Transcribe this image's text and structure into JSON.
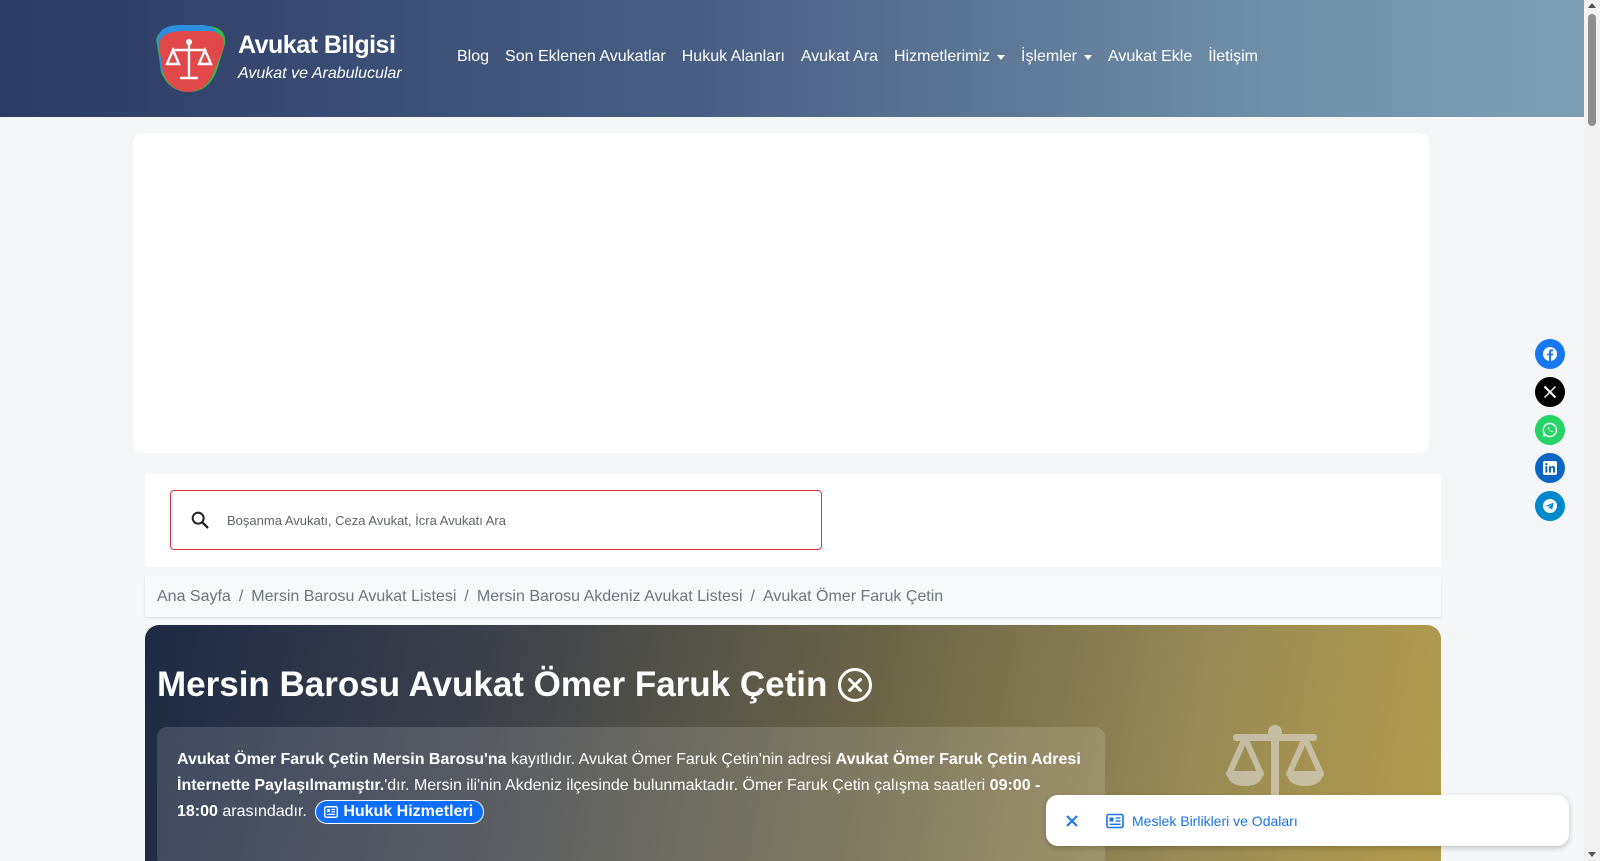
{
  "brand": {
    "title": "Avukat Bilgisi",
    "subtitle": "Avukat ve Arabulucular"
  },
  "nav": {
    "items": [
      {
        "label": "Blog",
        "dropdown": false
      },
      {
        "label": "Son Eklenen Avukatlar",
        "dropdown": false
      },
      {
        "label": "Hukuk Alanları",
        "dropdown": false
      },
      {
        "label": "Avukat Ara",
        "dropdown": false
      },
      {
        "label": "Hizmetlerimiz",
        "dropdown": true
      },
      {
        "label": "İşlemler",
        "dropdown": true
      },
      {
        "label": "Avukat Ekle",
        "dropdown": false
      },
      {
        "label": "İletişim",
        "dropdown": false
      }
    ]
  },
  "search": {
    "placeholder": "Boşanma Avukatı, Ceza Avukat, İcra Avukatı Ara",
    "value": ""
  },
  "breadcrumb": {
    "items": [
      "Ana Sayfa",
      "Mersin Barosu Avukat Listesi",
      "Mersin Barosu Akdeniz Avukat Listesi"
    ],
    "active": "Avukat Ömer Faruk Çetin",
    "separator": "/"
  },
  "hero": {
    "title": "Mersin Barosu Avukat Ömer Faruk Çetin",
    "status_icon": "x-circle-icon",
    "info": {
      "b1": "Avukat Ömer Faruk Çetin Mersin Barosu'na",
      "t1": " kayıtlıdır. Avukat Ömer Faruk Çetin'nin adresi ",
      "b2": "Avukat Ömer Faruk Çetin Adresi İnternette Paylaşılmamıştır.",
      "t2": "'dır. Mersin ili'nin Akdeniz ilçesinde bulunmaktadır. Ömer Faruk Çetin çalışma saatleri ",
      "b3": "09:00 - 18:00",
      "t3": " arasındadır."
    },
    "badge": "Hukuk Hizmetleri"
  },
  "social": [
    {
      "icon": "facebook-icon",
      "color": "#1877f2"
    },
    {
      "icon": "x-twitter-icon",
      "color": "#000000"
    },
    {
      "icon": "whatsapp-icon",
      "color": "#25d366"
    },
    {
      "icon": "linkedin-icon",
      "color": "#0a66c2"
    },
    {
      "icon": "telegram-icon",
      "color": "#0088cc"
    }
  ],
  "toast": {
    "text": "Meslek Birlikleri ve Odaları",
    "icon": "newspaper-icon"
  },
  "colors": {
    "accent": "#0d6efd",
    "search_border": "#dc3545",
    "toast_text": "#1a73e8"
  }
}
